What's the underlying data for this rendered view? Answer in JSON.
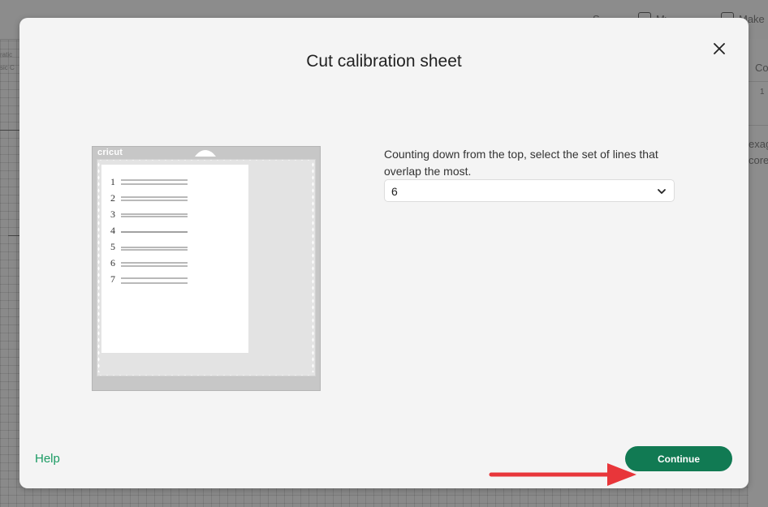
{
  "background": {
    "top_fragments": [
      "S",
      "My Stuff",
      "Make"
    ],
    "right_fragments": [
      "Co",
      "1",
      "exag",
      "core"
    ],
    "left_fragments": [
      "ratic",
      "sic C"
    ]
  },
  "dialog": {
    "title": "Cut calibration sheet",
    "close_icon": "close-icon",
    "instruction": "Counting down from the top, select the set of lines that overlap the most.",
    "select": {
      "value": "6",
      "icon": "chevron-down-icon"
    },
    "help_label": "Help",
    "continue_label": "Continue"
  },
  "mat": {
    "brand": "cricut",
    "calibration_numbers": [
      "1",
      "2",
      "3",
      "4",
      "5",
      "6",
      "7"
    ]
  },
  "colors": {
    "primary": "#117a53",
    "help_link": "#1a9b63",
    "annotation_arrow": "#e8363a"
  }
}
